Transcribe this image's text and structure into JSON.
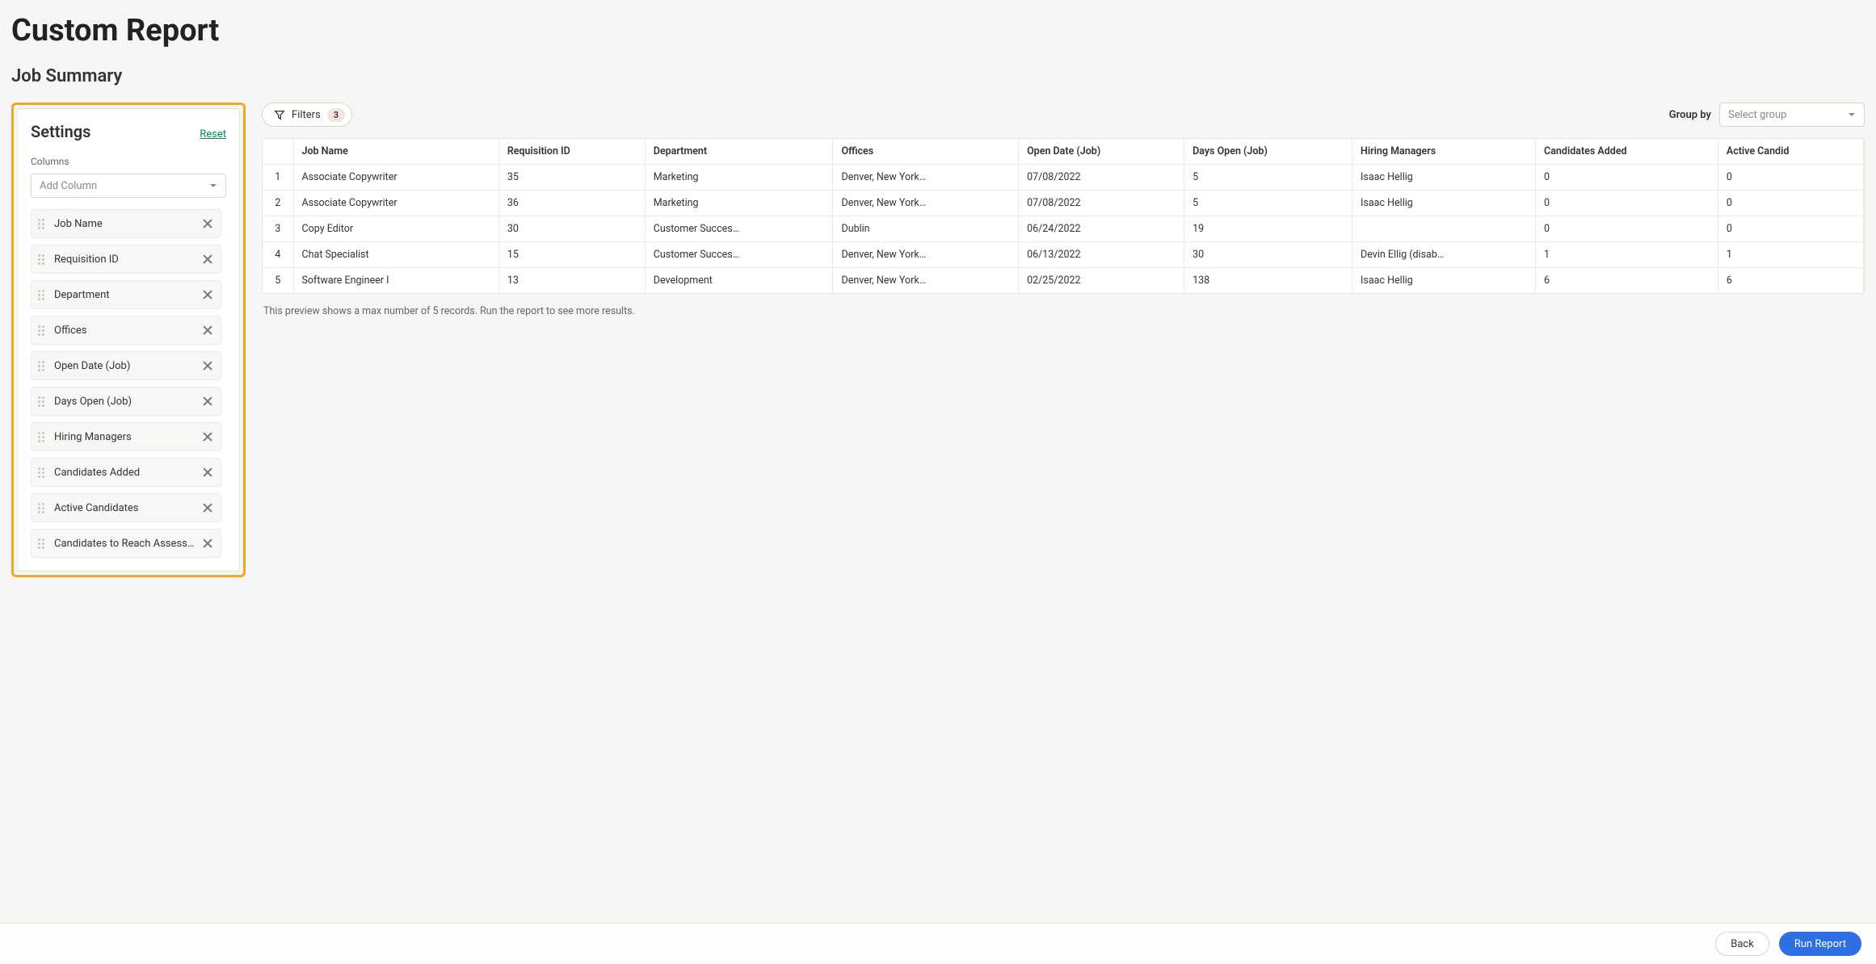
{
  "pageTitle": "Custom Report",
  "subtitle": "Job Summary",
  "settings": {
    "heading": "Settings",
    "resetLabel": "Reset",
    "columnsLabel": "Columns",
    "addColumnPlaceholder": "Add Column",
    "columns": [
      "Job Name",
      "Requisition ID",
      "Department",
      "Offices",
      "Open Date (Job)",
      "Days Open (Job)",
      "Hiring Managers",
      "Candidates Added",
      "Active Candidates",
      "Candidates to Reach Assess…"
    ]
  },
  "toolbar": {
    "filtersLabel": "Filters",
    "filtersCount": "3",
    "groupByLabel": "Group by",
    "groupByPlaceholder": "Select group"
  },
  "table": {
    "headers": [
      "",
      "Job Name",
      "Requisition ID",
      "Department",
      "Offices",
      "Open Date (Job)",
      "Days Open (Job)",
      "Hiring Managers",
      "Candidates Added",
      "Active Candid"
    ],
    "rows": [
      {
        "n": "1",
        "job": "Associate Copywriter",
        "req": "35",
        "dept": "Marketing",
        "off": "Denver, New York…",
        "open": "07/08/2022",
        "days": "5",
        "hm": "Isaac Hellig",
        "ca": "0",
        "ac": "0"
      },
      {
        "n": "2",
        "job": "Associate Copywriter",
        "req": "36",
        "dept": "Marketing",
        "off": "Denver, New York…",
        "open": "07/08/2022",
        "days": "5",
        "hm": "Isaac Hellig",
        "ca": "0",
        "ac": "0"
      },
      {
        "n": "3",
        "job": "Copy Editor",
        "req": "30",
        "dept": "Customer Succes…",
        "off": "Dublin",
        "open": "06/24/2022",
        "days": "19",
        "hm": "",
        "ca": "0",
        "ac": "0"
      },
      {
        "n": "4",
        "job": "Chat Specialist",
        "req": "15",
        "dept": "Customer Succes…",
        "off": "Denver, New York…",
        "open": "06/13/2022",
        "days": "30",
        "hm": "Devin Ellig (disab…",
        "ca": "1",
        "ac": "1"
      },
      {
        "n": "5",
        "job": "Software Engineer I",
        "req": "13",
        "dept": "Development",
        "off": "Denver, New York…",
        "open": "02/25/2022",
        "days": "138",
        "hm": "Isaac Hellig",
        "ca": "6",
        "ac": "6"
      }
    ]
  },
  "previewNote": "This preview shows a max number of 5 records. Run the report to see more results.",
  "footer": {
    "backLabel": "Back",
    "runLabel": "Run Report"
  }
}
